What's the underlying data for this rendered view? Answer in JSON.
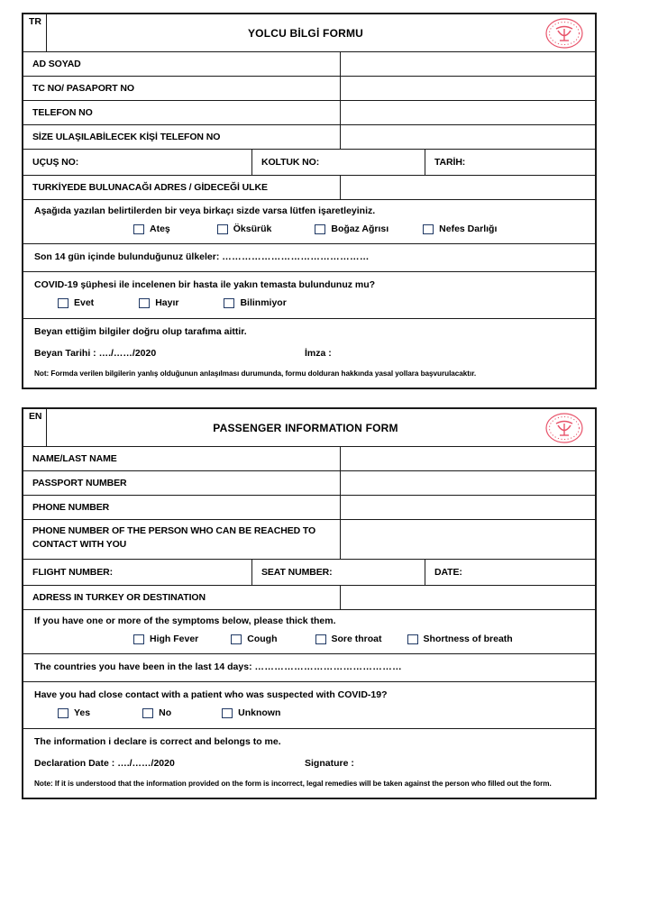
{
  "document": {
    "type": "passenger-information-form",
    "emblem_color": "#E8546B",
    "checkbox_color": "#1F3864"
  },
  "tr_section": {
    "lang_tag": "TR",
    "title": "YOLCU BİLGİ FORMU",
    "emblem_name": "ministry-of-health-emblem",
    "fields": [
      {
        "label": "AD     SOYAD",
        "value": ""
      },
      {
        "label": "TC NO/ PASAPORT NO",
        "value": ""
      },
      {
        "label": "TELEFON NO",
        "value": ""
      },
      {
        "label": "SİZE ULAŞILABİLECEK KİŞİ TELEFON  NO",
        "value": ""
      }
    ],
    "flight_row": {
      "flight_label": "UÇUŞ NO:",
      "flight_value": "",
      "seat_label": "KOLTUK NO:",
      "seat_value": "",
      "date_label": "TARİH:",
      "date_value": ""
    },
    "address_row": {
      "label": "TURKİYEDE BULUNACAĞI ADRES / GİDECEĞİ ULKE",
      "value": ""
    },
    "symptoms": {
      "prompt": "Aşağıda yazılan belirtilerden bir veya birkaçı sizde varsa lütfen işaretleyiniz.",
      "options": [
        "Ateş",
        "Öksürük",
        "Boğaz Ağrısı",
        "Nefes Darlığı"
      ]
    },
    "countries": {
      "label": "Son 14 gün içinde bulunduğunuz ülkeler:",
      "dots": "………………………………………"
    },
    "contact_question": {
      "prompt": "COVID-19 şüphesi ile incelenen bir hasta  ile yakın temasta bulundunuz mu?",
      "options": [
        "Evet",
        "Hayır",
        "Bilinmiyor"
      ]
    },
    "declaration": {
      "statement": "Beyan ettiğim bilgiler doğru olup tarafıma aittir.",
      "date_label": "Beyan Tarihi : …./……/2020",
      "signature_label": "İmza :",
      "note": "Not: Formda verilen bilgilerin  yanlış olduğunun anlaşılması durumunda, formu dolduran hakkında yasal yollara  başvurulacaktır."
    }
  },
  "en_section": {
    "lang_tag": "EN",
    "title": "PASSENGER INFORMATION FORM",
    "emblem_name": "ministry-of-health-emblem",
    "fields": [
      {
        "label": "NAME/LAST NAME",
        "value": ""
      },
      {
        "label": "PASSPORT NUMBER",
        "value": ""
      },
      {
        "label": "PHONE NUMBER",
        "value": ""
      }
    ],
    "contact_phone": {
      "label": "PHONE NUMBER OF THE PERSON  WHO CAN BE REACHED TO CONTACT WITH YOU",
      "value": ""
    },
    "flight_row": {
      "flight_label": "FLIGHT NUMBER:",
      "flight_value": "",
      "seat_label": "SEAT NUMBER:",
      "seat_value": "",
      "date_label": "DATE:",
      "date_value": ""
    },
    "address_row": {
      "label": "ADRESS IN TURKEY OR DESTINATION",
      "value": ""
    },
    "symptoms": {
      "prompt": "If you have one or more of the symptoms below, please thick them.",
      "options": [
        "High Fever",
        "Cough",
        "Sore throat",
        "Shortness of breath"
      ]
    },
    "countries": {
      "label": "The countries you have been in the last 14 days:",
      "dots": "………………………………………"
    },
    "contact_question": {
      "prompt": "Have you had close contact with a patient who was suspected with COVID-19?",
      "options": [
        "Yes",
        "No",
        "Unknown"
      ]
    },
    "declaration": {
      "statement": "The information i declare is correct and belongs to me.",
      "date_label": "Declaration Date : …./……/2020",
      "signature_label": "Signature :",
      "note": "Note: If it is understood that the information provided on the form is incorrect, legal remedies will be taken against the person who filled out the form."
    }
  }
}
